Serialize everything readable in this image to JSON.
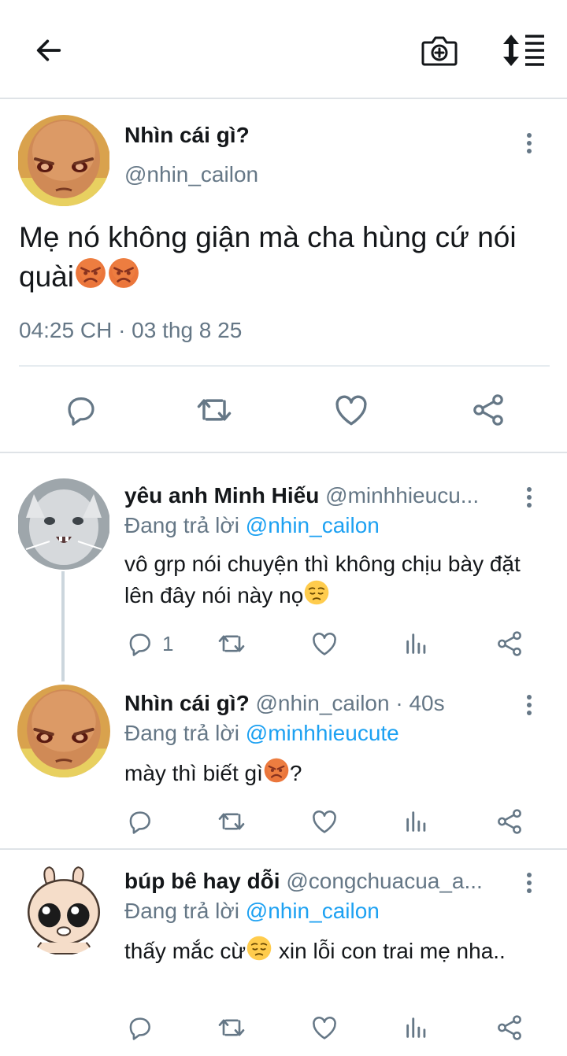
{
  "colors": {
    "accent": "#1da1f2",
    "secondary_text": "#657786",
    "icon": "#657786"
  },
  "topbar": {
    "back_icon": "arrow-left-icon",
    "camera_icon": "camera-plus-icon",
    "sort_icon": "sort-icon"
  },
  "main_tweet": {
    "name": "Nhìn cái gì?",
    "handle": "@nhin_cailon",
    "text": "Mẹ nó không giận mà cha hùng cứ nói quài",
    "emojis": [
      "angry-face-emoji",
      "angry-face-emoji"
    ],
    "timestamp": "04:25 CH · 03 thg 8 25",
    "actions": [
      "reply-icon",
      "retweet-icon",
      "like-icon",
      "share-icon"
    ]
  },
  "replies": [
    {
      "name": "yêu anh Minh Hiếu",
      "handle": "@minhhieucu...",
      "replying_label": "Đang trả lời",
      "replying_to": "@nhin_cailon",
      "text": "vô grp nói chuyện thì không chịu bày đặt lên đây nói này nọ",
      "emoji": "pensive-face-emoji",
      "reply_count": "1"
    },
    {
      "name": "Nhìn cái gì?",
      "handle": "@nhin_cailon · 40s",
      "replying_label": "Đang trả lời",
      "replying_to": "@minhhieucute",
      "text_before": "mày thì biết gì",
      "emoji": "angry-face-emoji",
      "text_after": "?"
    },
    {
      "name": "búp bê hay dỗi",
      "handle": "@congchuacua_a...",
      "replying_label": "Đang trả lời",
      "replying_to": "@nhin_cailon",
      "text_before": "thấy mắc cừ",
      "emoji": "pensive-face-emoji",
      "text_after": " xin lỗi con trai mẹ nha.."
    }
  ]
}
